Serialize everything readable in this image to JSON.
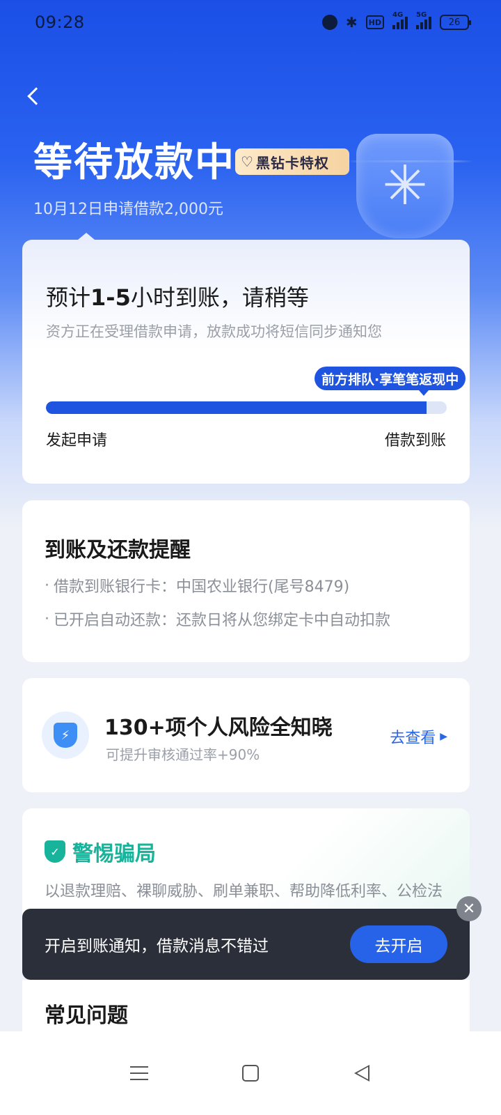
{
  "status_bar": {
    "time": "09:28",
    "icons": [
      "alarm-icon",
      "bluetooth-icon",
      "hd-icon",
      "4g-signal-icon",
      "5g-signal-icon",
      "battery-icon"
    ],
    "hd_label": "HD",
    "signal1_label": "4G",
    "signal2_label": "5G",
    "battery": "26"
  },
  "header": {
    "title": "等待放款中",
    "vip_badge": "黑钻卡特权",
    "subtitle": "10月12日申请借款2,000元"
  },
  "progress_card": {
    "title_pre": "预计",
    "title_bold": "1-5",
    "title_post": "小时到账，请稍等",
    "description": "资方正在受理借款申请，放款成功将短信同步通知您",
    "queue_tag": "前方排队·享笔笔返现中",
    "progress": 0.95,
    "start_label": "发起申请",
    "end_label": "借款到账"
  },
  "reminder_card": {
    "title": "到账及还款提醒",
    "items": [
      "借款到账银行卡：中国农业银行(尾号8479)",
      "已开启自动还款：还款日将从您绑定卡中自动扣款"
    ]
  },
  "risk_card": {
    "title": "130+项个人风险全知晓",
    "subtitle": "可提升审核通过率+90%",
    "link": "去查看"
  },
  "fraud_card": {
    "title": "警惕骗局",
    "text": "以退款理赔、裸聊威胁、刷单兼职、帮助降低利率、公检法等，都涉嫌诈骗，请提高警惕"
  },
  "toast": {
    "text": "开启到账通知，借款消息不错过",
    "button": "去开启"
  },
  "faq_card": {
    "title": "常见问题"
  },
  "colors": {
    "primary": "#1f54e0",
    "accent_green": "#17b39b",
    "toast_bg": "#2b2f3a"
  }
}
